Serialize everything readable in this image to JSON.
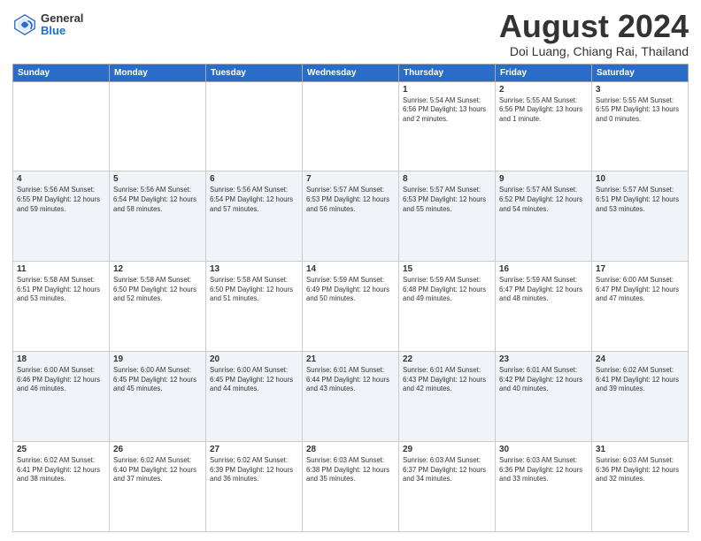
{
  "header": {
    "logo_general": "General",
    "logo_blue": "Blue",
    "month_title": "August 2024",
    "location": "Doi Luang, Chiang Rai, Thailand"
  },
  "days_of_week": [
    "Sunday",
    "Monday",
    "Tuesday",
    "Wednesday",
    "Thursday",
    "Friday",
    "Saturday"
  ],
  "weeks": [
    [
      {
        "day": "",
        "info": ""
      },
      {
        "day": "",
        "info": ""
      },
      {
        "day": "",
        "info": ""
      },
      {
        "day": "",
        "info": ""
      },
      {
        "day": "1",
        "info": "Sunrise: 5:54 AM\nSunset: 6:56 PM\nDaylight: 13 hours\nand 2 minutes."
      },
      {
        "day": "2",
        "info": "Sunrise: 5:55 AM\nSunset: 6:56 PM\nDaylight: 13 hours\nand 1 minute."
      },
      {
        "day": "3",
        "info": "Sunrise: 5:55 AM\nSunset: 6:55 PM\nDaylight: 13 hours\nand 0 minutes."
      }
    ],
    [
      {
        "day": "4",
        "info": "Sunrise: 5:56 AM\nSunset: 6:55 PM\nDaylight: 12 hours\nand 59 minutes."
      },
      {
        "day": "5",
        "info": "Sunrise: 5:56 AM\nSunset: 6:54 PM\nDaylight: 12 hours\nand 58 minutes."
      },
      {
        "day": "6",
        "info": "Sunrise: 5:56 AM\nSunset: 6:54 PM\nDaylight: 12 hours\nand 57 minutes."
      },
      {
        "day": "7",
        "info": "Sunrise: 5:57 AM\nSunset: 6:53 PM\nDaylight: 12 hours\nand 56 minutes."
      },
      {
        "day": "8",
        "info": "Sunrise: 5:57 AM\nSunset: 6:53 PM\nDaylight: 12 hours\nand 55 minutes."
      },
      {
        "day": "9",
        "info": "Sunrise: 5:57 AM\nSunset: 6:52 PM\nDaylight: 12 hours\nand 54 minutes."
      },
      {
        "day": "10",
        "info": "Sunrise: 5:57 AM\nSunset: 6:51 PM\nDaylight: 12 hours\nand 53 minutes."
      }
    ],
    [
      {
        "day": "11",
        "info": "Sunrise: 5:58 AM\nSunset: 6:51 PM\nDaylight: 12 hours\nand 53 minutes."
      },
      {
        "day": "12",
        "info": "Sunrise: 5:58 AM\nSunset: 6:50 PM\nDaylight: 12 hours\nand 52 minutes."
      },
      {
        "day": "13",
        "info": "Sunrise: 5:58 AM\nSunset: 6:50 PM\nDaylight: 12 hours\nand 51 minutes."
      },
      {
        "day": "14",
        "info": "Sunrise: 5:59 AM\nSunset: 6:49 PM\nDaylight: 12 hours\nand 50 minutes."
      },
      {
        "day": "15",
        "info": "Sunrise: 5:59 AM\nSunset: 6:48 PM\nDaylight: 12 hours\nand 49 minutes."
      },
      {
        "day": "16",
        "info": "Sunrise: 5:59 AM\nSunset: 6:47 PM\nDaylight: 12 hours\nand 48 minutes."
      },
      {
        "day": "17",
        "info": "Sunrise: 6:00 AM\nSunset: 6:47 PM\nDaylight: 12 hours\nand 47 minutes."
      }
    ],
    [
      {
        "day": "18",
        "info": "Sunrise: 6:00 AM\nSunset: 6:46 PM\nDaylight: 12 hours\nand 46 minutes."
      },
      {
        "day": "19",
        "info": "Sunrise: 6:00 AM\nSunset: 6:45 PM\nDaylight: 12 hours\nand 45 minutes."
      },
      {
        "day": "20",
        "info": "Sunrise: 6:00 AM\nSunset: 6:45 PM\nDaylight: 12 hours\nand 44 minutes."
      },
      {
        "day": "21",
        "info": "Sunrise: 6:01 AM\nSunset: 6:44 PM\nDaylight: 12 hours\nand 43 minutes."
      },
      {
        "day": "22",
        "info": "Sunrise: 6:01 AM\nSunset: 6:43 PM\nDaylight: 12 hours\nand 42 minutes."
      },
      {
        "day": "23",
        "info": "Sunrise: 6:01 AM\nSunset: 6:42 PM\nDaylight: 12 hours\nand 40 minutes."
      },
      {
        "day": "24",
        "info": "Sunrise: 6:02 AM\nSunset: 6:41 PM\nDaylight: 12 hours\nand 39 minutes."
      }
    ],
    [
      {
        "day": "25",
        "info": "Sunrise: 6:02 AM\nSunset: 6:41 PM\nDaylight: 12 hours\nand 38 minutes."
      },
      {
        "day": "26",
        "info": "Sunrise: 6:02 AM\nSunset: 6:40 PM\nDaylight: 12 hours\nand 37 minutes."
      },
      {
        "day": "27",
        "info": "Sunrise: 6:02 AM\nSunset: 6:39 PM\nDaylight: 12 hours\nand 36 minutes."
      },
      {
        "day": "28",
        "info": "Sunrise: 6:03 AM\nSunset: 6:38 PM\nDaylight: 12 hours\nand 35 minutes."
      },
      {
        "day": "29",
        "info": "Sunrise: 6:03 AM\nSunset: 6:37 PM\nDaylight: 12 hours\nand 34 minutes."
      },
      {
        "day": "30",
        "info": "Sunrise: 6:03 AM\nSunset: 6:36 PM\nDaylight: 12 hours\nand 33 minutes."
      },
      {
        "day": "31",
        "info": "Sunrise: 6:03 AM\nSunset: 6:36 PM\nDaylight: 12 hours\nand 32 minutes."
      }
    ]
  ],
  "row_classes": [
    "row-normal",
    "row-alt",
    "row-normal",
    "row-alt",
    "row-normal"
  ]
}
